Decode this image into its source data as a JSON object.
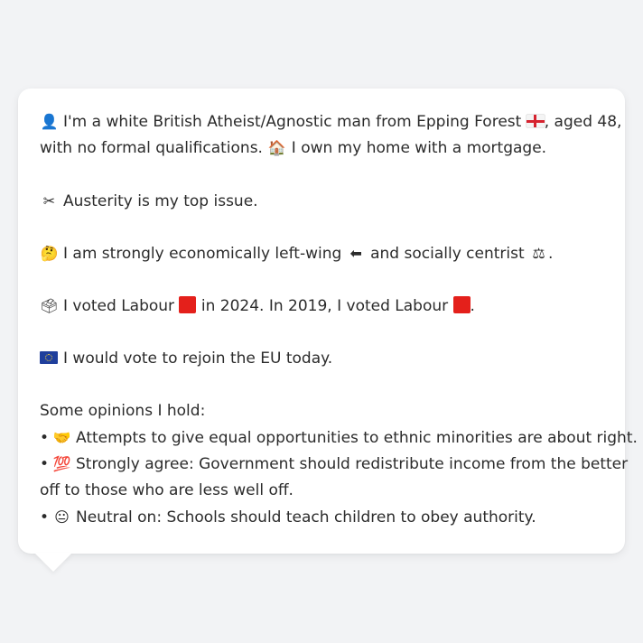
{
  "profile": {
    "identity_icon": "👤",
    "identity_text": "I'm a white British Atheist/Agnostic man from Epping Forest",
    "identity_flag": "england-flag",
    "identity_tail": ", aged 48,",
    "identity_line2": "with no formal qualifications.",
    "home_icon": "🏠",
    "home_text": "I own my home with a mortgage."
  },
  "issue": {
    "icon": "✂",
    "text": "Austerity is my top issue."
  },
  "politics": {
    "icon": "🤔",
    "text_a": "I am strongly economically left-wing",
    "left_icon": "⬅",
    "text_b": "and socially centrist",
    "scale_icon": "⚖",
    "text_c": "."
  },
  "voting": {
    "icon": "🗳",
    "text_a": "I voted Labour",
    "text_b": "in 2024. In 2019, I voted Labour",
    "text_c": ".",
    "labour_color": "#e4201b"
  },
  "eu": {
    "icon": "eu-flag",
    "text": "I would vote to rejoin the EU today."
  },
  "opinions": {
    "heading": "Some opinions I hold:",
    "bullet": "•",
    "items": [
      {
        "icon": "🤝",
        "text": "Attempts to give equal opportunities to ethnic minorities are about right."
      },
      {
        "icon": "💯",
        "text": "Strongly agree: Government should redistribute income from the better",
        "text_cont": "off to those who are less well off."
      },
      {
        "icon": "😐",
        "text": "Neutral on: Schools should teach children to obey authority."
      }
    ]
  }
}
